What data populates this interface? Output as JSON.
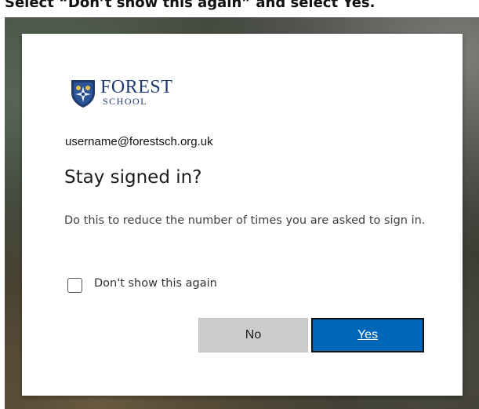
{
  "instruction": {
    "text": "Select “Don’t show this again” and select Yes."
  },
  "branding": {
    "name": "FOREST",
    "subname": "SCHOOL",
    "crest_icon": "school-crest-icon",
    "primary_color": "#1f3a6e"
  },
  "account": {
    "username": "username@forestsch.org.uk"
  },
  "dialog": {
    "title": "Stay signed in?",
    "description": "Do this to reduce the number of times you are asked to sign in.",
    "checkbox_label": "Don't show this again",
    "checkbox_checked": false,
    "no_label": "No",
    "yes_label": "Yes"
  },
  "colors": {
    "yes_button": "#0067b8",
    "no_button": "#cccccc"
  }
}
